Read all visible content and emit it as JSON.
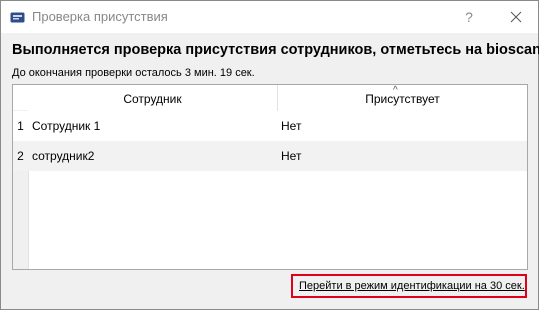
{
  "window": {
    "title": "Проверка присутствия",
    "help_label": "?",
    "icon": "id-card-icon"
  },
  "heading": "Выполняется проверка присутствия сотрудников, отметьтесь на bioscan",
  "countdown": "До окончания проверки осталось  3 мин.  19 сек.",
  "table": {
    "sort_indicator": "^",
    "columns": [
      "Сотрудник",
      "Присутствует"
    ],
    "rows": [
      {
        "num": "1",
        "employee": "Сотрудник 1",
        "present": "Нет"
      },
      {
        "num": "2",
        "employee": "сотрудник2",
        "present": "Нет"
      }
    ]
  },
  "footer": {
    "link_label": "Перейти в режим идентификации на 30 сек."
  },
  "colors": {
    "highlight_border": "#e0001b",
    "window_bg": "#f0f0f0",
    "icon_blue": "#2f4d8c"
  }
}
